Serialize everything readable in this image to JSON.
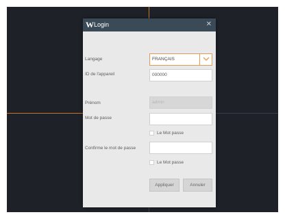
{
  "dialog": {
    "logo": "W",
    "title": "Login",
    "close_glyph": "✕"
  },
  "form": {
    "language_label": "Langage",
    "language_value": "FRANÇAIS",
    "device_id_label": "ID de l'appareil",
    "device_id_value": "000000",
    "first_name_label": "Prénom",
    "first_name_value": "admin",
    "password_label": "Mot de passe",
    "password_value": "",
    "show_password_label": "Le Mot passe",
    "confirm_label": "Confirme le mot de passe",
    "confirm_value": "",
    "show_confirm_label": "Le Mot passe"
  },
  "buttons": {
    "apply": "Appliquer",
    "cancel": "Annuler"
  },
  "colors": {
    "background": "#1f2129",
    "titlebar": "#3a4b57",
    "dialog": "#e9e9e9",
    "accent": "#e49a55"
  },
  "icons": {
    "logo": "logo-icon",
    "close": "close-icon",
    "dropdown": "chevron-down-icon"
  }
}
